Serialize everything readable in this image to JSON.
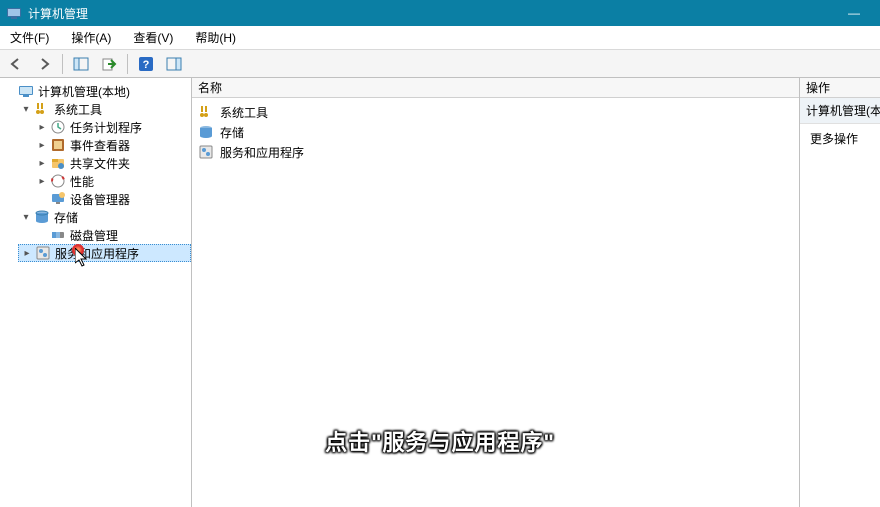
{
  "window": {
    "title": "计算机管理",
    "minimize": "—"
  },
  "menu": {
    "file": "文件(F)",
    "action": "操作(A)",
    "view": "查看(V)",
    "help": "帮助(H)"
  },
  "tree": {
    "root": "计算机管理(本地)",
    "system_tools": "系统工具",
    "task_scheduler": "任务计划程序",
    "event_viewer": "事件查看器",
    "shared_folders": "共享文件夹",
    "performance": "性能",
    "device_manager": "设备管理器",
    "storage": "存储",
    "disk_management": "磁盘管理",
    "services_apps": "服务和应用程序"
  },
  "list": {
    "header_name": "名称",
    "items": [
      {
        "label": "系统工具"
      },
      {
        "label": "存储"
      },
      {
        "label": "服务和应用程序"
      }
    ]
  },
  "actions": {
    "header": "操作",
    "section": "计算机管理(本地)",
    "more": "更多操作"
  },
  "caption": "点击\"服务与应用程序\""
}
